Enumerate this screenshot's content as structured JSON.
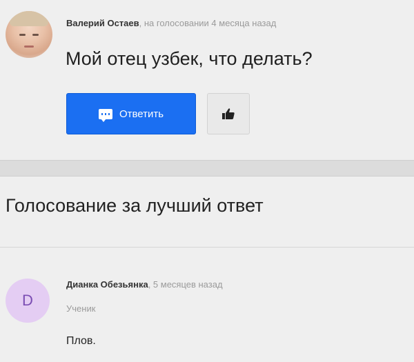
{
  "question": {
    "author": "Валерий Остаев",
    "time": ", на голосовании 4 месяца назад",
    "text": "Мой отец узбек, что делать?",
    "reply_label": "Ответить"
  },
  "section": {
    "title": "Голосование за лучший ответ"
  },
  "answer": {
    "avatar_letter": "D",
    "author": "Дианка Обезьянка",
    "time": ", 5 месяцев назад",
    "role": "Ученик",
    "text": "Плов."
  },
  "colors": {
    "primary_button": "#1b6ff2",
    "avatar_letter_bg": "#e4cdf3",
    "avatar_letter_fg": "#7b4db3"
  },
  "icons": {
    "reply": "comment-icon",
    "like": "thumbs-up-icon"
  }
}
